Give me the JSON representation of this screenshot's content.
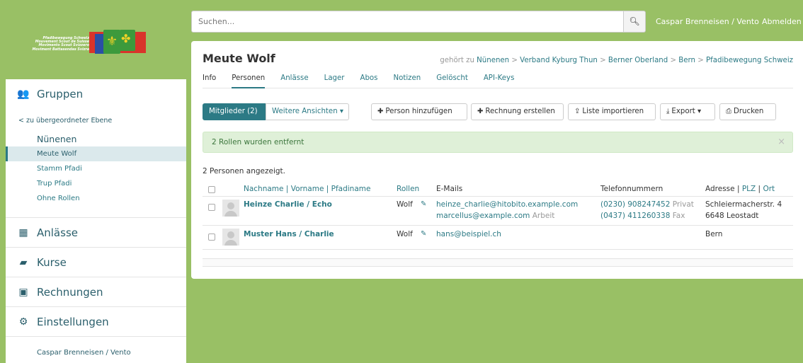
{
  "logo": {
    "lines": [
      "Pfadibewegung Schweiz",
      "Mouvement Scout de Suisse",
      "Movimento Scout Svizzero",
      "Moviment Battasendas Svizra"
    ]
  },
  "topbar": {
    "search_placeholder": "Suchen...",
    "search_icon": "search-icon",
    "user": "Caspar Brenneisen / Vento",
    "logout": "Abmelden"
  },
  "sidebar": {
    "groups_label": "Gruppen",
    "back_link": "< zu übergeordneter Ebene",
    "current_group": "Nünenen",
    "items": [
      {
        "label": "Meute Wolf",
        "active": true
      },
      {
        "label": "Stamm Pfadi",
        "active": false
      },
      {
        "label": "Trup Pfadi",
        "active": false
      },
      {
        "label": "Ohne Rollen",
        "active": false
      }
    ],
    "nav": [
      {
        "label": "Anlässe",
        "icon": "calendar-icon"
      },
      {
        "label": "Kurse",
        "icon": "book-icon"
      },
      {
        "label": "Rechnungen",
        "icon": "money-icon"
      },
      {
        "label": "Einstellungen",
        "icon": "gear-icon"
      }
    ],
    "user_link": "Caspar Brenneisen / Vento"
  },
  "page": {
    "title": "Meute Wolf",
    "belongs_prefix": "gehört zu",
    "breadcrumb": [
      "Nünenen",
      "Verband Kyburg Thun",
      "Berner Oberland",
      "Bern",
      "Pfadibewegung Schweiz"
    ],
    "tabs": [
      "Info",
      "Personen",
      "Anlässe",
      "Lager",
      "Abos",
      "Notizen",
      "Gelöscht",
      "API-Keys"
    ],
    "active_tab": "Personen"
  },
  "toolbar": {
    "members": "Mitglieder (2)",
    "more_views": "Weitere Ansichten",
    "add_person": "Person hinzufügen",
    "create_invoice": "Rechnung erstellen",
    "import_list": "Liste importieren",
    "export": "Export",
    "print": "Drucken"
  },
  "alert": {
    "text": "2 Rollen wurden entfernt",
    "close": "×"
  },
  "table": {
    "count_text": "2 Personen angezeigt.",
    "headers": {
      "nachname": "Nachname",
      "vorname": "Vorname",
      "pfadiname": "Pfadiname",
      "rollen": "Rollen",
      "emails": "E-Mails",
      "telefon": "Telefonnummern",
      "adresse": "Adresse",
      "plz": "PLZ",
      "ort": "Ort"
    },
    "rows": [
      {
        "name": "Heinze Charlie / Echo",
        "role": "Wolf",
        "email1": "heinze_charlie@hitobito.example.com",
        "email2": "marcellus@example.com",
        "email2_label": "Arbeit",
        "phone1": "(0230) 908247452",
        "phone1_label": "Privat",
        "phone2": "(0437) 411260338",
        "phone2_label": "Fax",
        "address1": "Schleiermacherstr. 4",
        "address2": "6648 Leostadt"
      },
      {
        "name": "Muster Hans / Charlie",
        "role": "Wolf",
        "email1": "hans@beispiel.ch",
        "address1": "Bern"
      }
    ]
  }
}
